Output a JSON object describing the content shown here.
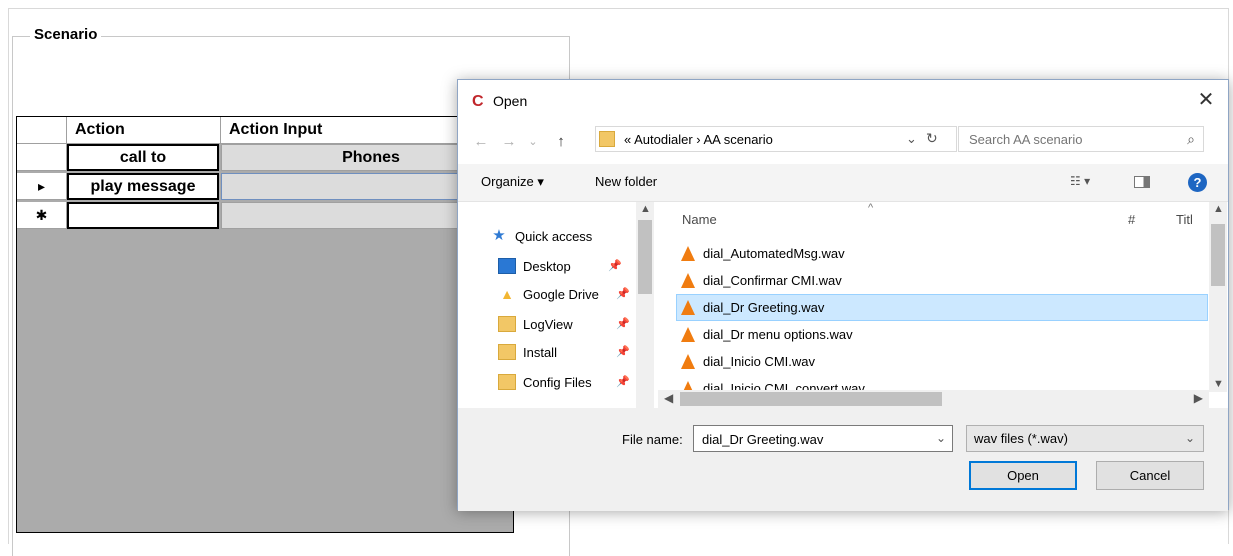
{
  "scenario": {
    "title": "Scenario",
    "headers": [
      "Action",
      "Action Input"
    ],
    "rows": [
      {
        "indicator": "",
        "action": "call to",
        "input": "Phones"
      },
      {
        "indicator": "▸",
        "action": "play message",
        "input": ""
      },
      {
        "indicator": "✱",
        "action": "",
        "input": ""
      }
    ]
  },
  "dialog": {
    "title": "Open",
    "close": "✕",
    "nav": {
      "back": "←",
      "forward": "→",
      "recent": "⌄",
      "up": "↑"
    },
    "address": {
      "crumbs": "« Autodialer › AA scenario",
      "dropdown": "⌄",
      "refresh": "↻"
    },
    "search_placeholder": "Search AA scenario",
    "toolbar": {
      "organize": "Organize ▾",
      "new_folder": "New folder",
      "view": "☷ ▾",
      "help": "?"
    },
    "nav_pane": [
      {
        "label": "Quick access",
        "icon": "star-icon"
      },
      {
        "label": "Desktop",
        "icon": "desktop-icon",
        "pinned": true
      },
      {
        "label": "Google Drive",
        "icon": "google-drive-icon",
        "pinned": true
      },
      {
        "label": "LogView",
        "icon": "folder-icon",
        "pinned": true
      },
      {
        "label": "Install",
        "icon": "folder-icon",
        "pinned": true
      },
      {
        "label": "Config Files",
        "icon": "folder-icon",
        "pinned": true
      }
    ],
    "columns": {
      "name": "Name",
      "number": "#",
      "title": "Titl"
    },
    "files": [
      {
        "name": "dial_AutomatedMsg.wav",
        "selected": false
      },
      {
        "name": "dial_Confirmar CMI.wav",
        "selected": false
      },
      {
        "name": "dial_Dr Greeting.wav",
        "selected": true
      },
      {
        "name": "dial_Dr menu options.wav",
        "selected": false
      },
      {
        "name": "dial_Inicio CMI.wav",
        "selected": false
      },
      {
        "name": "dial_Inicio CMI_convert.wav",
        "selected": false
      }
    ],
    "file_name_label": "File name:",
    "file_name_value": "dial_Dr Greeting.wav",
    "file_type": "wav files (*.wav)",
    "open_label": "Open",
    "cancel_label": "Cancel"
  }
}
